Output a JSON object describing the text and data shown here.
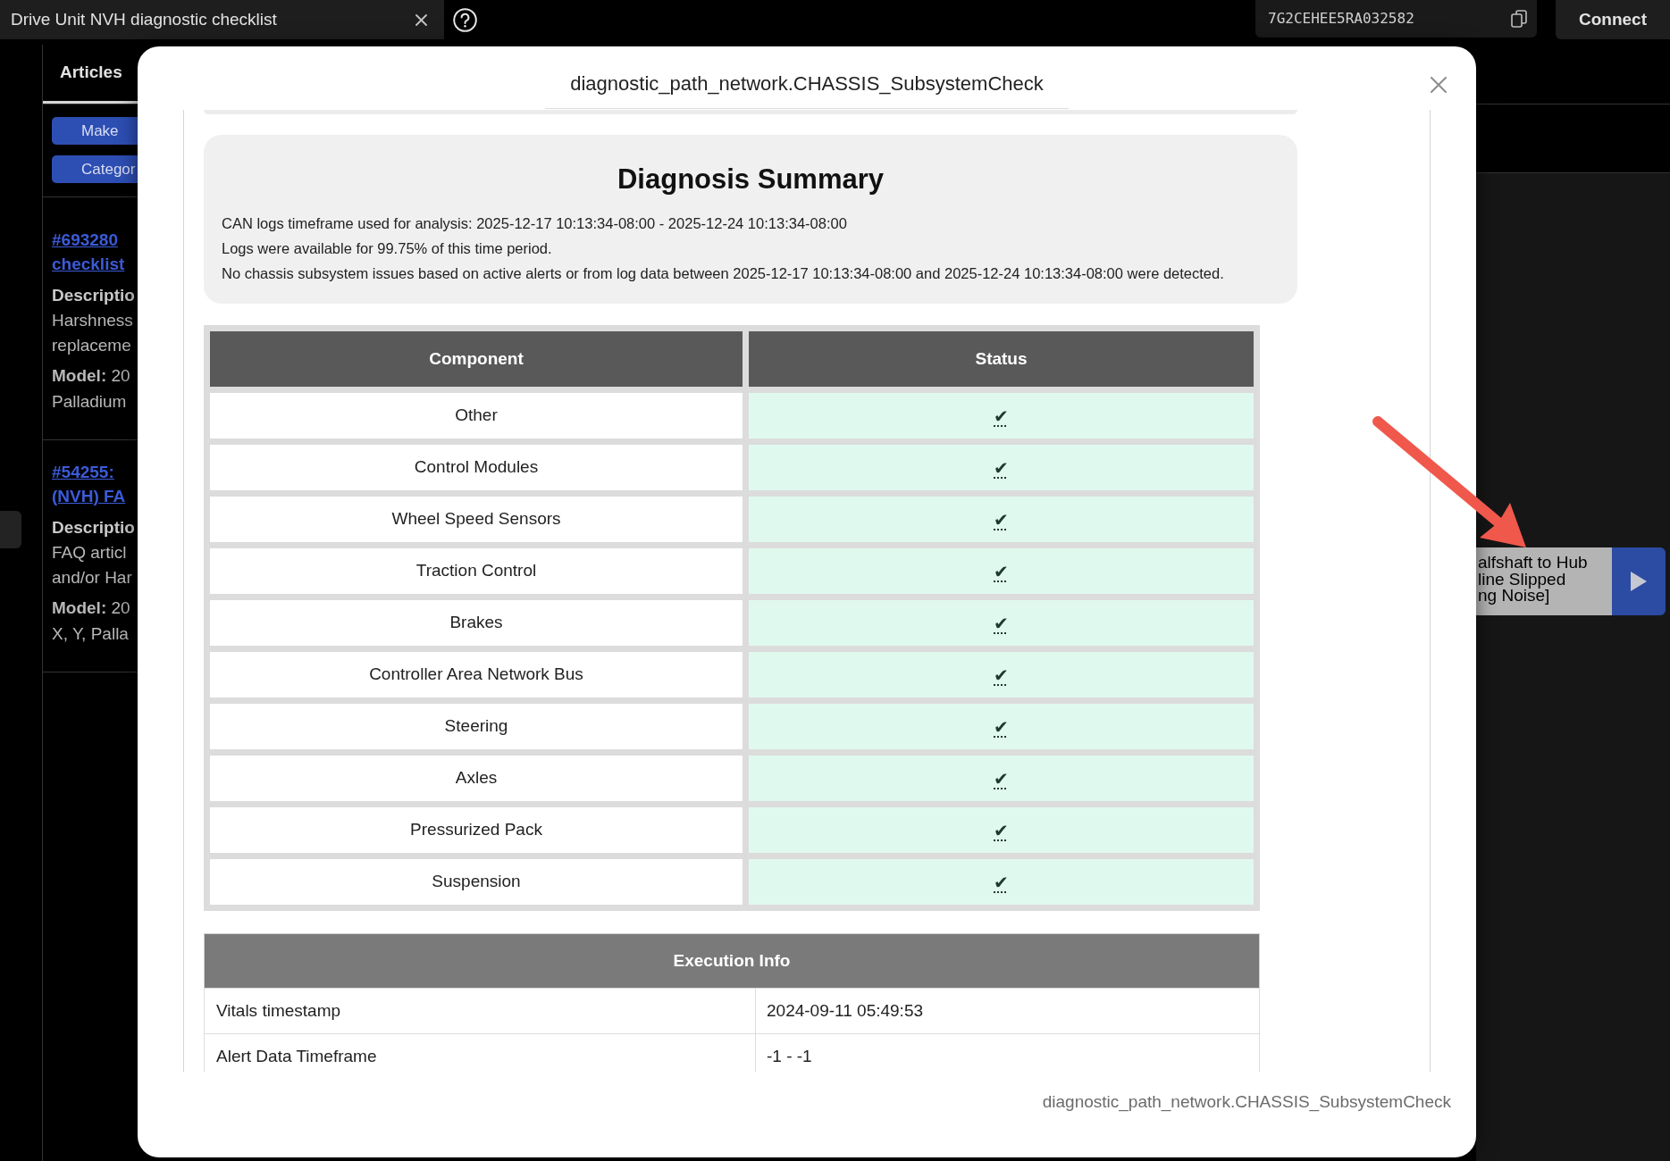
{
  "top_bar": {
    "tab": {
      "title": "Drive Unit NVH diagnostic checklist"
    },
    "vin": "7G2CEHEE5RA032582",
    "connect_button": "Connect"
  },
  "sidebar": {
    "tabs": [
      {
        "label": "Articles",
        "selected": true
      }
    ],
    "filters": [
      "Make",
      "Categor"
    ],
    "articles": [
      {
        "title_lines": [
          "#693280",
          "checklist"
        ],
        "description_label": "Descriptio",
        "description_lines": [
          "Harshness",
          "replaceme"
        ],
        "model_lines": [
          "**Model:** 20",
          "Palladium"
        ]
      },
      {
        "title_lines": [
          "#54255:",
          "(NVH) FA"
        ],
        "description_label": "Descriptio",
        "description_lines": [
          "FAQ articl",
          "and/or Har"
        ],
        "model_lines": [
          "**Model:** 20",
          "X, Y, Palla"
        ]
      }
    ]
  },
  "side_list_item": {
    "text_lines": [
      "alfshaft to Hub",
      "line Slipped",
      "ng Noise]"
    ]
  },
  "dialog": {
    "title": "diagnostic_path_network.CHASSIS_SubsystemCheck",
    "summary": {
      "heading": "Diagnosis Summary",
      "lines": [
        "CAN logs timeframe used for analysis: 2025-12-17 10:13:34-08:00 - 2025-12-24 10:13:34-08:00",
        "Logs were available for 99.75% of this time period.",
        "No chassis subsystem issues based on active alerts or from log data between 2025-12-17 10:13:34-08:00 and 2025-12-24 10:13:34-08:00 were detected."
      ]
    },
    "component_table": {
      "columns": [
        "Component",
        "Status"
      ],
      "rows": [
        {
          "component": "Other",
          "status": "✔",
          "passed": true
        },
        {
          "component": "Control Modules",
          "status": "✔",
          "passed": true
        },
        {
          "component": "Wheel Speed Sensors",
          "status": "✔",
          "passed": true
        },
        {
          "component": "Traction Control",
          "status": "✔",
          "passed": true
        },
        {
          "component": "Brakes",
          "status": "✔",
          "passed": true
        },
        {
          "component": "Controller Area Network Bus",
          "status": "✔",
          "passed": true
        },
        {
          "component": "Steering",
          "status": "✔",
          "passed": true
        },
        {
          "component": "Axles",
          "status": "✔",
          "passed": true
        },
        {
          "component": "Pressurized Pack",
          "status": "✔",
          "passed": true
        },
        {
          "component": "Suspension",
          "status": "✔",
          "passed": true
        }
      ]
    },
    "execution_info": {
      "heading": "Execution Info",
      "rows": [
        {
          "label": "Vitals timestamp",
          "value": "2024-09-11 05:49:53"
        },
        {
          "label": "Alert Data Timeframe",
          "value": "-1 - -1"
        }
      ]
    },
    "footer": "diagnostic_path_network.CHASSIS_SubsystemCheck"
  }
}
